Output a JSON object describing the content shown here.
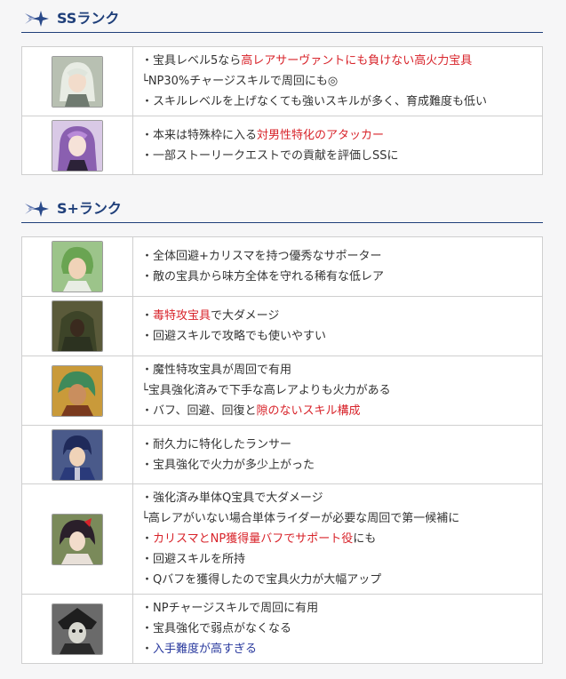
{
  "sections": [
    {
      "title": "SSランク",
      "rows": [
        {
          "avatar": "servant-portrait-white-haired",
          "lines": [
            [
              {
                "t": "・宝具レベル5なら"
              },
              {
                "t": "高レアサーヴァントにも負けない高火力宝具",
                "c": "red"
              }
            ],
            [
              {
                "t": "└NP30%チャージスキルで周回にも◎"
              }
            ],
            [
              {
                "t": "・スキルレベルを上げなくても強いスキルが多く、育成難度も低い"
              }
            ]
          ]
        },
        {
          "avatar": "servant-portrait-purple-haired",
          "lines": [
            [
              {
                "t": "・本来は特殊枠に入る"
              },
              {
                "t": "対男性特化のアタッカー",
                "c": "red"
              }
            ],
            [
              {
                "t": "・一部ストーリークエストでの貢献を評価しSSに"
              }
            ]
          ]
        }
      ]
    },
    {
      "title": "S+ランク",
      "rows": [
        {
          "avatar": "servant-portrait-green-haired",
          "lines": [
            [
              {
                "t": "・全体回避+カリスマを持つ優秀なサポーター"
              }
            ],
            [
              {
                "t": "・敵の宝具から味方全体を守れる稀有な低レア"
              }
            ]
          ]
        },
        {
          "avatar": "servant-portrait-hooded-archer",
          "lines": [
            [
              {
                "t": "・"
              },
              {
                "t": "毒特攻宝具",
                "c": "red"
              },
              {
                "t": "で大ダメージ"
              }
            ],
            [
              {
                "t": "・回避スキルで攻略でも使いやすい"
              }
            ]
          ]
        },
        {
          "avatar": "servant-portrait-green-haired-warrior",
          "lines": [
            [
              {
                "t": "・魔性特攻宝具が周回で有用"
              }
            ],
            [
              {
                "t": "└宝具強化済みで下手な高レアよりも火力がある"
              }
            ],
            [
              {
                "t": "・バフ、回避、回復と"
              },
              {
                "t": "隙のないスキル構成",
                "c": "red"
              }
            ]
          ]
        },
        {
          "avatar": "servant-portrait-blue-lancer",
          "lines": [
            [
              {
                "t": "・耐久力に特化したランサー"
              }
            ],
            [
              {
                "t": "・宝具強化で火力が多少上がった"
              }
            ]
          ]
        },
        {
          "avatar": "servant-portrait-dark-haired-rider",
          "lines": [
            [
              {
                "t": "・強化済み単体Q宝具で大ダメージ"
              }
            ],
            [
              {
                "t": "└高レアがいない場合単体ライダーが必要な周回で第一候補に"
              }
            ],
            [
              {
                "t": "・"
              },
              {
                "t": "カリスマとNP獲得量バフでサポート役",
                "c": "red"
              },
              {
                "t": "にも"
              }
            ],
            [
              {
                "t": "・回避スキルを所持"
              }
            ],
            [
              {
                "t": "・Qバフを獲得したので宝具火力が大幅アップ"
              }
            ]
          ]
        },
        {
          "avatar": "servant-portrait-masked-assassin",
          "lines": [
            [
              {
                "t": "・NPチャージスキルで周回に有用"
              }
            ],
            [
              {
                "t": "・宝具強化で弱点がなくなる"
              }
            ],
            [
              {
                "t": "・"
              },
              {
                "t": "入手難度が高すぎる",
                "c": "blue"
              }
            ]
          ]
        }
      ]
    }
  ]
}
